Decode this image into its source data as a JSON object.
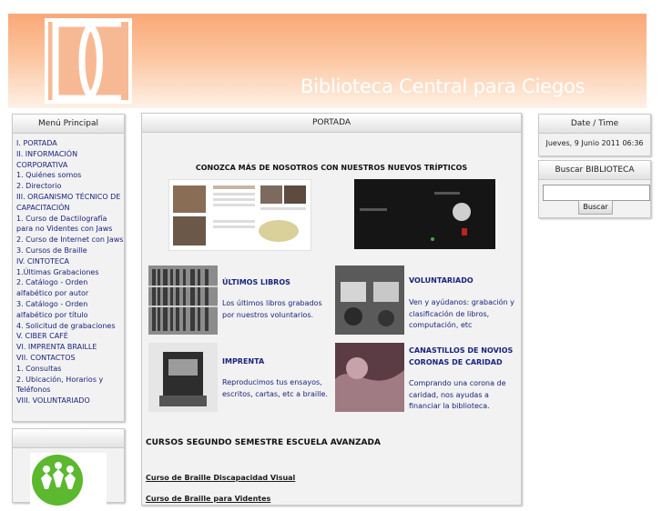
{
  "header": {
    "title": "Biblioteca Central para Ciegos"
  },
  "menu": {
    "title": "Menú Principal",
    "items": [
      "I. PORTADA",
      "II. INFORMACIÓN CORPORATIVA",
      "1. Quiénes somos",
      "2. Directorio",
      "III. ORGANISMO TÉCNICO DE CAPACITACIÓN",
      "1. Curso de Dactilografía para no Videntes con Jaws",
      "2. Curso de Internet con Jaws",
      "3. Cursos de Braille",
      "IV. CINTOTECA",
      "1.Últimas Grabaciones",
      "2. Catálogo - Orden alfabético por autor",
      "3. Catálogo - Orden alfabético por título",
      "4. Solicitud de grabaciones",
      "V. CIBER CAFÉ",
      "VI. IMPRENTA BRAILLE",
      "VII. CONTACTOS",
      "1. Consultas",
      "2. Ubicación, Horarios y Teléfonos",
      "VIII. VOLUNTARIADO"
    ]
  },
  "main": {
    "title": "PORTADA",
    "tripticos": "CONOZCA MÁS DE NOSOTROS CON NUESTROS NUEVOS TRÍPTICOS",
    "features": {
      "libros": {
        "title": "ÚLTIMOS LIBROS",
        "text": "Los últimos libros grabados por nuestros voluntarios."
      },
      "voluntariado": {
        "title": "VOLUNTARIADO",
        "text": "Ven y ayúdanos: grabación y clasificación de libros, computación, etc"
      },
      "imprenta": {
        "title": "IMPRENTA",
        "text": "Reproducimos tus ensayos, escritos, cartas, etc a braille."
      },
      "canastillos": {
        "title": "CANASTILLOS DE NOVIOS CORONAS DE CARIDAD",
        "text": "Comprando una corona de caridad, nos ayudas a financiar la biblioteca."
      }
    },
    "cursos_title": "CURSOS SEGUNDO SEMESTRE ESCUELA AVANZADA",
    "links": [
      "Curso de Braille Discapacidad Visual",
      "Curso de Braille para Videntes"
    ]
  },
  "date": {
    "title": "Date / Time",
    "value": "Jueves, 9 Junio 2011 06:36"
  },
  "search": {
    "title": "Buscar BIBLIOTECA",
    "input_value": "",
    "button": "Buscar"
  }
}
